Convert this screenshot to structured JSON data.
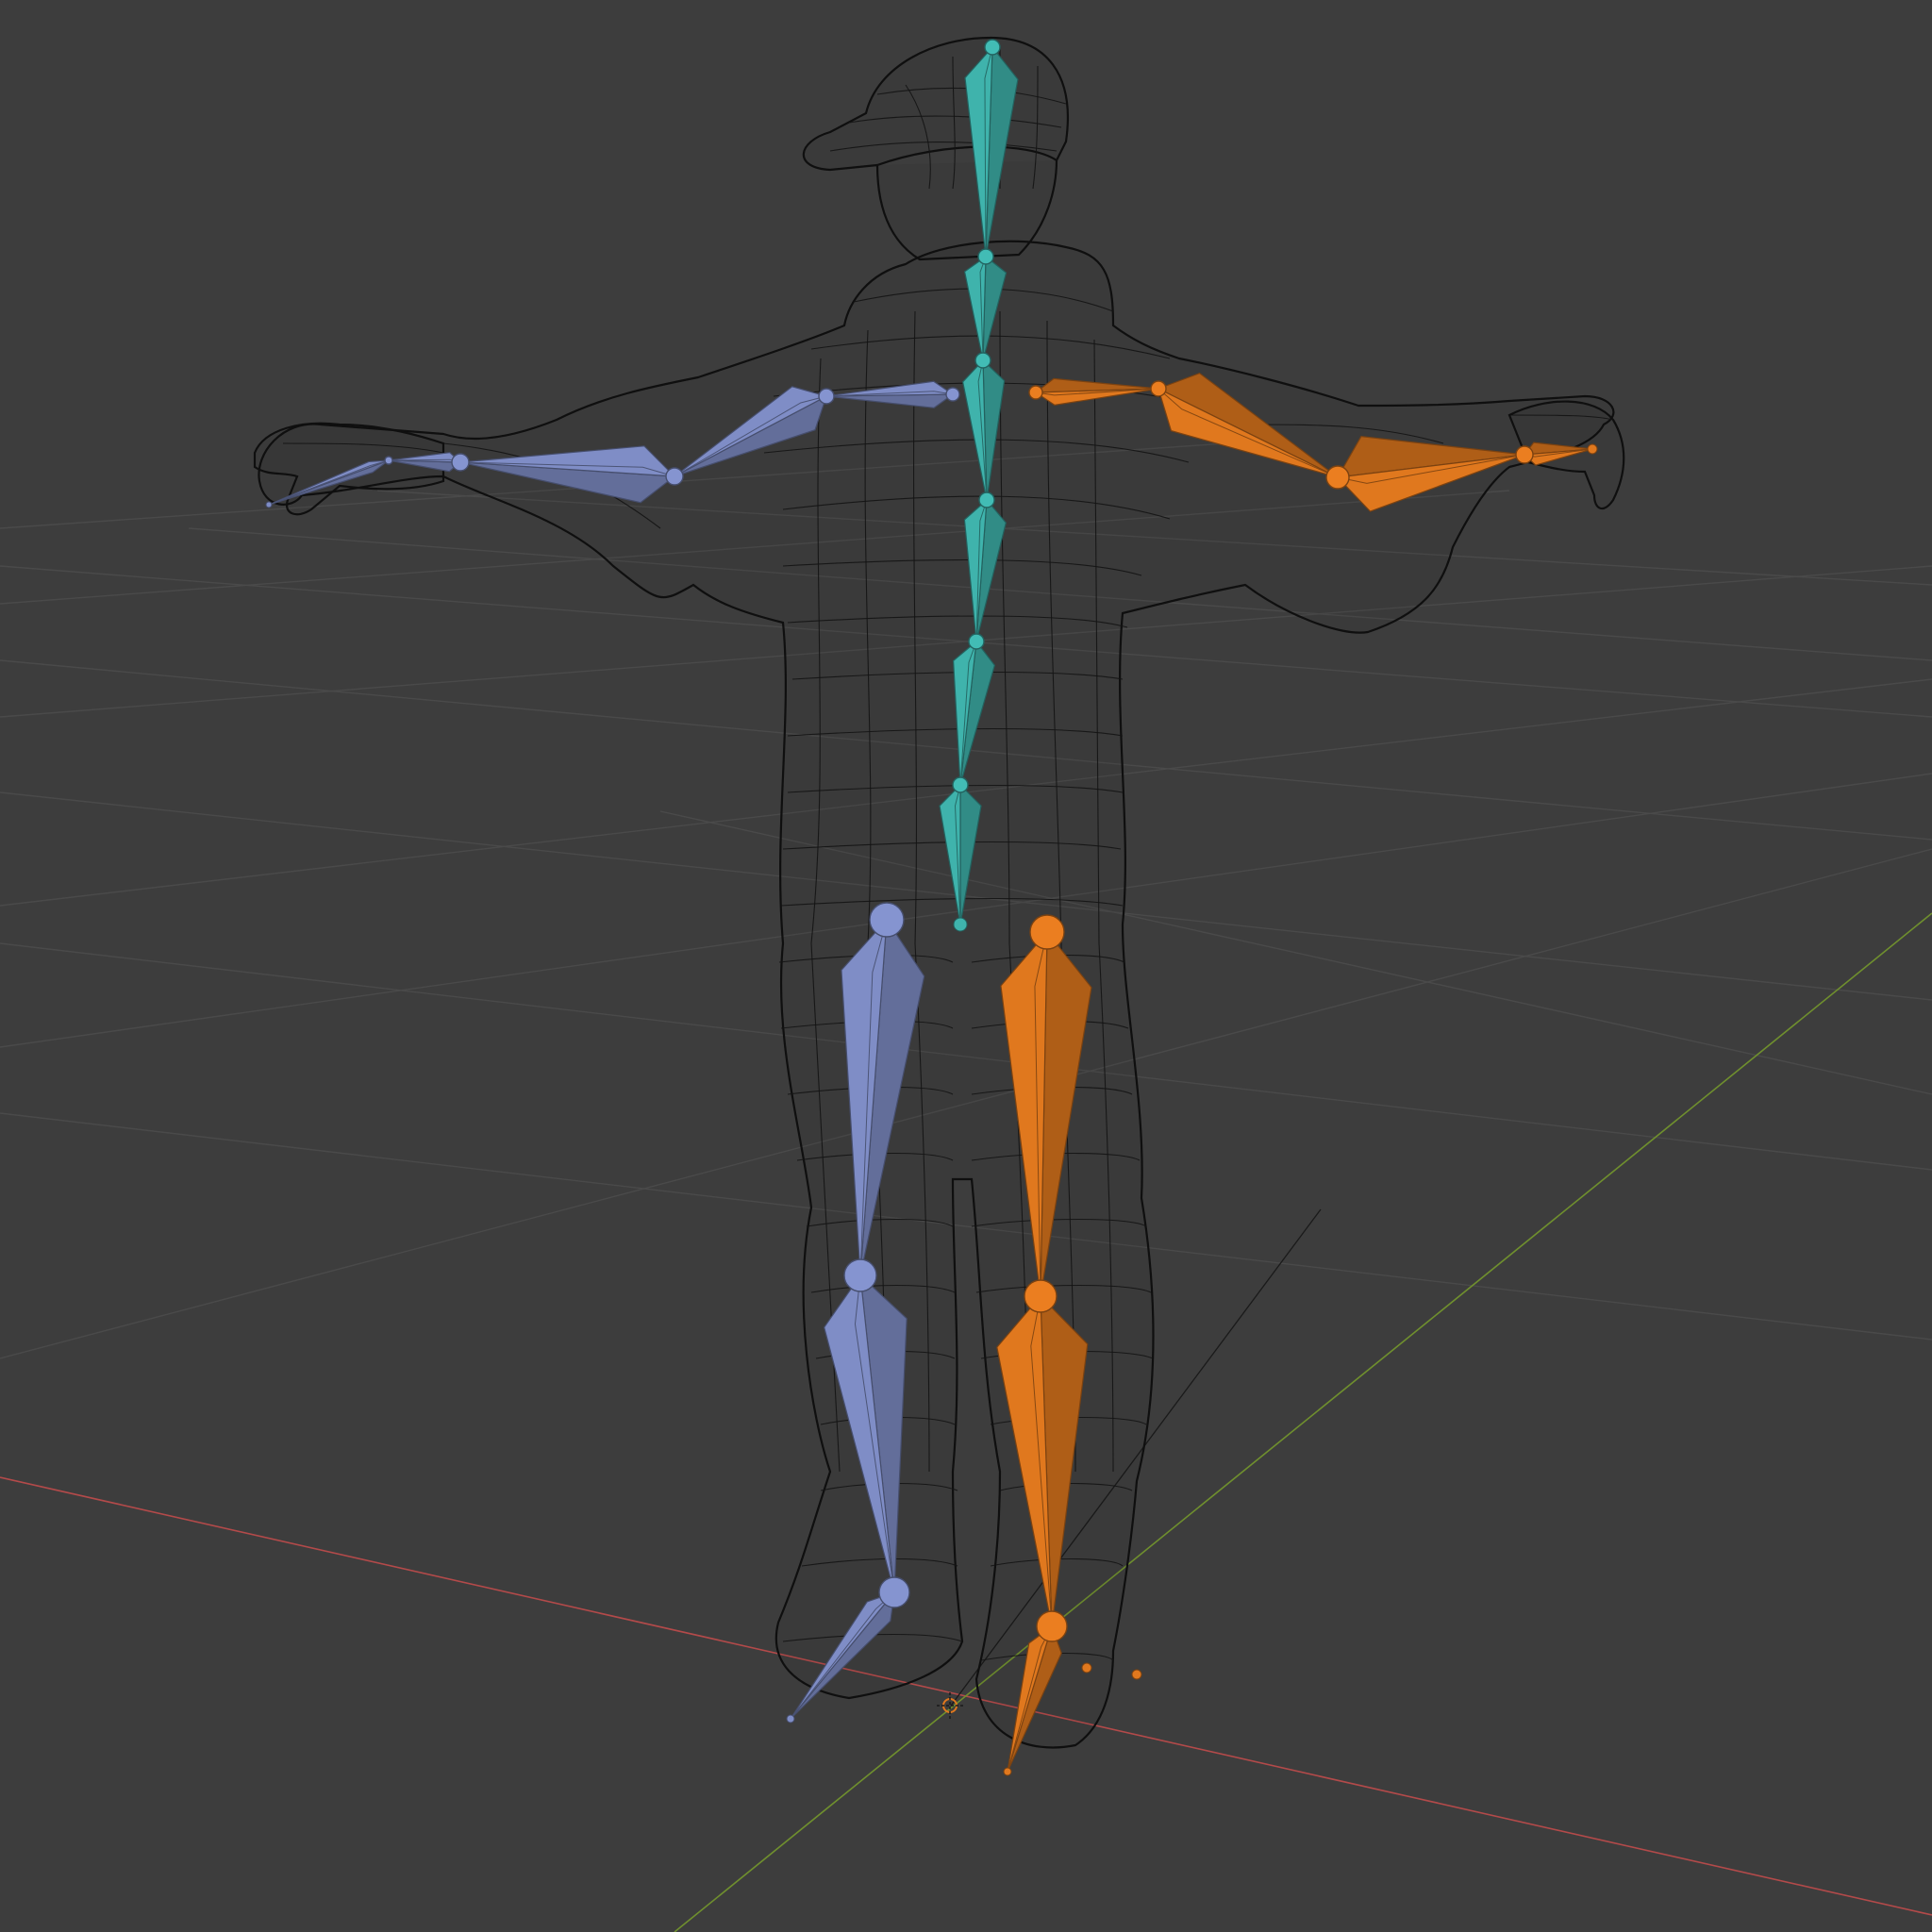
{
  "viewport": {
    "background_color": "#3d3d3d",
    "grid_color": "#4a4a4a",
    "x_axis_color": "#b34a4a",
    "y_axis_color": "#6f8f2e",
    "wireframe_color": "#141414"
  },
  "armature": {
    "spine_color": "#3fb3ac",
    "left_color": "#7f8dc6",
    "right_color": "#e0781e",
    "spine_bones": [
      "head",
      "neck",
      "chest",
      "spine",
      "spine-lower",
      "hips"
    ],
    "left_bones": [
      "shoulder-l",
      "upper-arm-l",
      "forearm-l",
      "hand-l",
      "thigh-l",
      "shin-l",
      "foot-l"
    ],
    "right_bones": [
      "shoulder-r",
      "upper-arm-r",
      "forearm-r",
      "hand-r",
      "thigh-r",
      "shin-r",
      "foot-r"
    ]
  },
  "object_origin_icon": "crosshair-icon"
}
